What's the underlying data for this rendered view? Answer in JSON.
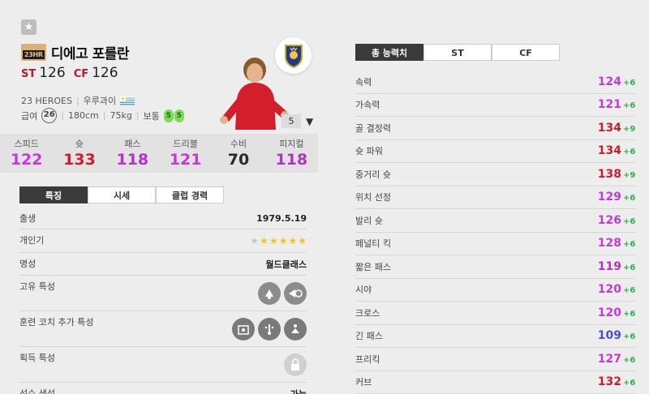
{
  "colors": {
    "pink": "#c43ad7",
    "red": "#c81e2d",
    "purple": "#b133c4",
    "dark": "#2a2a2a",
    "blue": "#4b4fd6",
    "green": "#2bb24c"
  },
  "player": {
    "season_badge": "23HR",
    "name": "디에고 포를란",
    "positions": [
      {
        "code": "ST",
        "value": "126"
      },
      {
        "code": "CF",
        "value": "126"
      }
    ],
    "season_name": "23 HEROES",
    "nation": "우루과이",
    "pay_label": "급여",
    "pay_value": "26",
    "height": "180cm",
    "weight": "75kg",
    "body_type": "보통",
    "weak_foot": "5",
    "strong_foot": "5",
    "level": "5"
  },
  "summary_stats": [
    {
      "label": "스피드",
      "value": "122",
      "color": "#c43ad7"
    },
    {
      "label": "슛",
      "value": "133",
      "color": "#c81e2d"
    },
    {
      "label": "패스",
      "value": "118",
      "color": "#b133c4"
    },
    {
      "label": "드리블",
      "value": "121",
      "color": "#c43ad7"
    },
    {
      "label": "수비",
      "value": "70",
      "color": "#2a2a2a"
    },
    {
      "label": "피지컬",
      "value": "118",
      "color": "#b133c4"
    }
  ],
  "left_tabs": [
    "특징",
    "시세",
    "클럽 경력"
  ],
  "traits": {
    "birth_label": "출생",
    "birth_value": "1979.5.19",
    "popularity_label": "개인기",
    "popularity_stars": 5,
    "reputation_label": "명성",
    "reputation_value": "월드클래스",
    "unique_label": "고유 특성",
    "coach_label": "훈련 코치 추가 특성",
    "acquired_label": "획득 특성",
    "creation_label": "선수 생성",
    "creation_value": "가능"
  },
  "right_tabs": [
    "총 능력치",
    "ST",
    "CF"
  ],
  "attributes": [
    {
      "label": "속력",
      "value": "124",
      "bonus": "+6",
      "color": "#c43ad7"
    },
    {
      "label": "가속력",
      "value": "121",
      "bonus": "+6",
      "color": "#c43ad7"
    },
    {
      "label": "골 결정력",
      "value": "134",
      "bonus": "+9",
      "color": "#c81e2d"
    },
    {
      "label": "슛 파워",
      "value": "134",
      "bonus": "+6",
      "color": "#c81e2d"
    },
    {
      "label": "중거리 슛",
      "value": "138",
      "bonus": "+9",
      "color": "#c81e2d"
    },
    {
      "label": "위치 선정",
      "value": "129",
      "bonus": "+6",
      "color": "#c43ad7"
    },
    {
      "label": "발리 슛",
      "value": "126",
      "bonus": "+6",
      "color": "#c43ad7"
    },
    {
      "label": "페널티 킥",
      "value": "128",
      "bonus": "+6",
      "color": "#c43ad7"
    },
    {
      "label": "짧은 패스",
      "value": "119",
      "bonus": "+6",
      "color": "#b133c4"
    },
    {
      "label": "시야",
      "value": "120",
      "bonus": "+6",
      "color": "#c43ad7"
    },
    {
      "label": "크로스",
      "value": "120",
      "bonus": "+6",
      "color": "#c43ad7"
    },
    {
      "label": "긴 패스",
      "value": "109",
      "bonus": "+6",
      "color": "#4b4fd6"
    },
    {
      "label": "프리킥",
      "value": "127",
      "bonus": "+6",
      "color": "#c43ad7"
    },
    {
      "label": "커브",
      "value": "132",
      "bonus": "+6",
      "color": "#c81e2d"
    }
  ]
}
